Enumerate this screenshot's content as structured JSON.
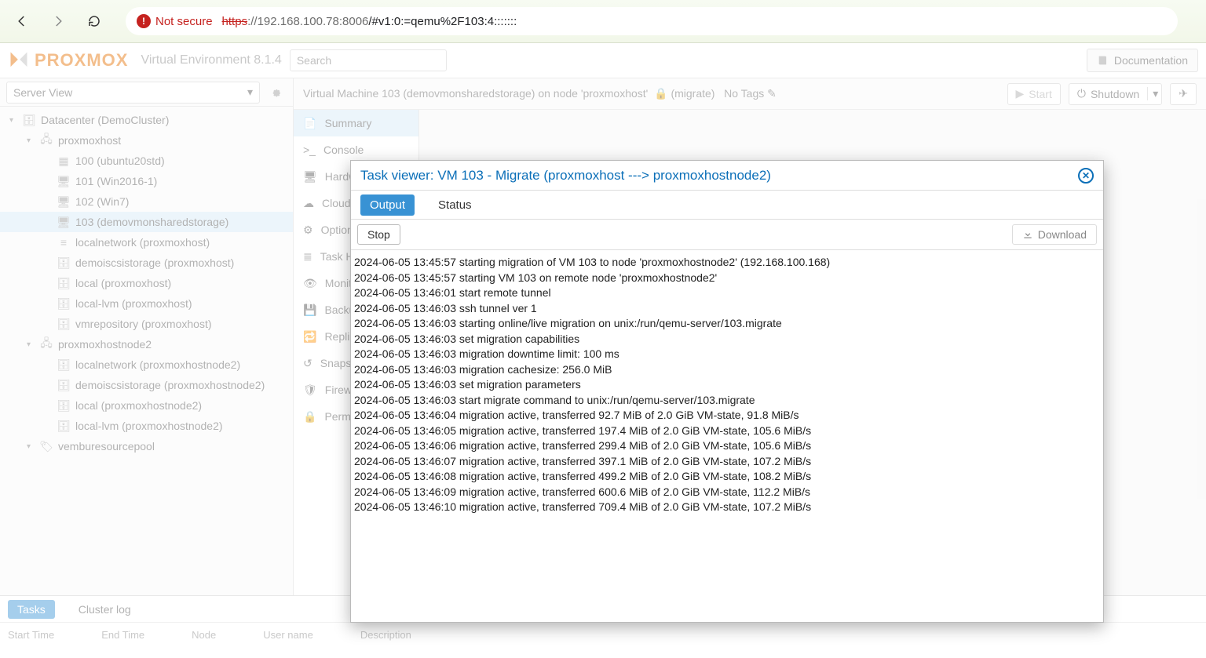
{
  "browser": {
    "not_secure": "Not secure",
    "url_strike": "https",
    "url_host": "://192.168.100.78:8006",
    "url_path": "/#v1:0:=qemu%2F103:4:::::::"
  },
  "header": {
    "product": "PROXMOX",
    "env": "Virtual Environment 8.1.4",
    "search_placeholder": "Search",
    "documentation": "Documentation"
  },
  "view_label": "Server View",
  "tree": {
    "root": "Datacenter (DemoCluster)",
    "nodes": [
      {
        "name": "proxmoxhost",
        "children": [
          "100 (ubuntu20std)",
          "101 (Win2016-1)",
          "102 (Win7)",
          "103 (demovmonsharedstorage)",
          "localnetwork (proxmoxhost)",
          "demoiscsistorage (proxmoxhost)",
          "local (proxmoxhost)",
          "local-lvm (proxmoxhost)",
          "vmrepository (proxmoxhost)"
        ]
      },
      {
        "name": "proxmoxhostnode2",
        "children": [
          "localnetwork (proxmoxhostnode2)",
          "demoiscsistorage (proxmoxhostnode2)",
          "local (proxmoxhostnode2)",
          "local-lvm (proxmoxhostnode2)"
        ]
      }
    ],
    "pool": "vemburesourcepool"
  },
  "midtabs": {
    "summary": "Summary",
    "console": "Console",
    "hardware": "Hardware",
    "cloudinit": "Cloud-Init",
    "options": "Options",
    "tasks": "Task History",
    "monitor": "Monitor",
    "backup": "Backup",
    "replication": "Replication",
    "snapshots": "Snapshots",
    "firewall": "Firewall",
    "permissions": "Permissions"
  },
  "content": {
    "title": "Virtual Machine 103 (demovmonsharedstorage) on node 'proxmoxhost'",
    "migrate": "(migrate)",
    "notags": "No Tags",
    "start": "Start",
    "shutdown": "Shutdown"
  },
  "bottom": {
    "tasks": "Tasks",
    "cluster": "Cluster log",
    "cols": {
      "start": "Start Time",
      "end": "End Time",
      "node": "Node",
      "user": "User name",
      "desc": "Description"
    }
  },
  "modal": {
    "title": "Task viewer: VM 103 - Migrate (proxmoxhost ---> proxmoxhostnode2)",
    "tab_output": "Output",
    "tab_status": "Status",
    "stop": "Stop",
    "download": "Download",
    "log": [
      "2024-06-05 13:45:57 starting migration of VM 103 to node 'proxmoxhostnode2' (192.168.100.168)",
      "2024-06-05 13:45:57 starting VM 103 on remote node 'proxmoxhostnode2'",
      "2024-06-05 13:46:01 start remote tunnel",
      "2024-06-05 13:46:03 ssh tunnel ver 1",
      "2024-06-05 13:46:03 starting online/live migration on unix:/run/qemu-server/103.migrate",
      "2024-06-05 13:46:03 set migration capabilities",
      "2024-06-05 13:46:03 migration downtime limit: 100 ms",
      "2024-06-05 13:46:03 migration cachesize: 256.0 MiB",
      "2024-06-05 13:46:03 set migration parameters",
      "2024-06-05 13:46:03 start migrate command to unix:/run/qemu-server/103.migrate",
      "2024-06-05 13:46:04 migration active, transferred 92.7 MiB of 2.0 GiB VM-state, 91.8 MiB/s",
      "2024-06-05 13:46:05 migration active, transferred 197.4 MiB of 2.0 GiB VM-state, 105.6 MiB/s",
      "2024-06-05 13:46:06 migration active, transferred 299.4 MiB of 2.0 GiB VM-state, 105.6 MiB/s",
      "2024-06-05 13:46:07 migration active, transferred 397.1 MiB of 2.0 GiB VM-state, 107.2 MiB/s",
      "2024-06-05 13:46:08 migration active, transferred 499.2 MiB of 2.0 GiB VM-state, 108.2 MiB/s",
      "2024-06-05 13:46:09 migration active, transferred 600.6 MiB of 2.0 GiB VM-state, 112.2 MiB/s",
      "2024-06-05 13:46:10 migration active, transferred 709.4 MiB of 2.0 GiB VM-state, 107.2 MiB/s"
    ]
  }
}
